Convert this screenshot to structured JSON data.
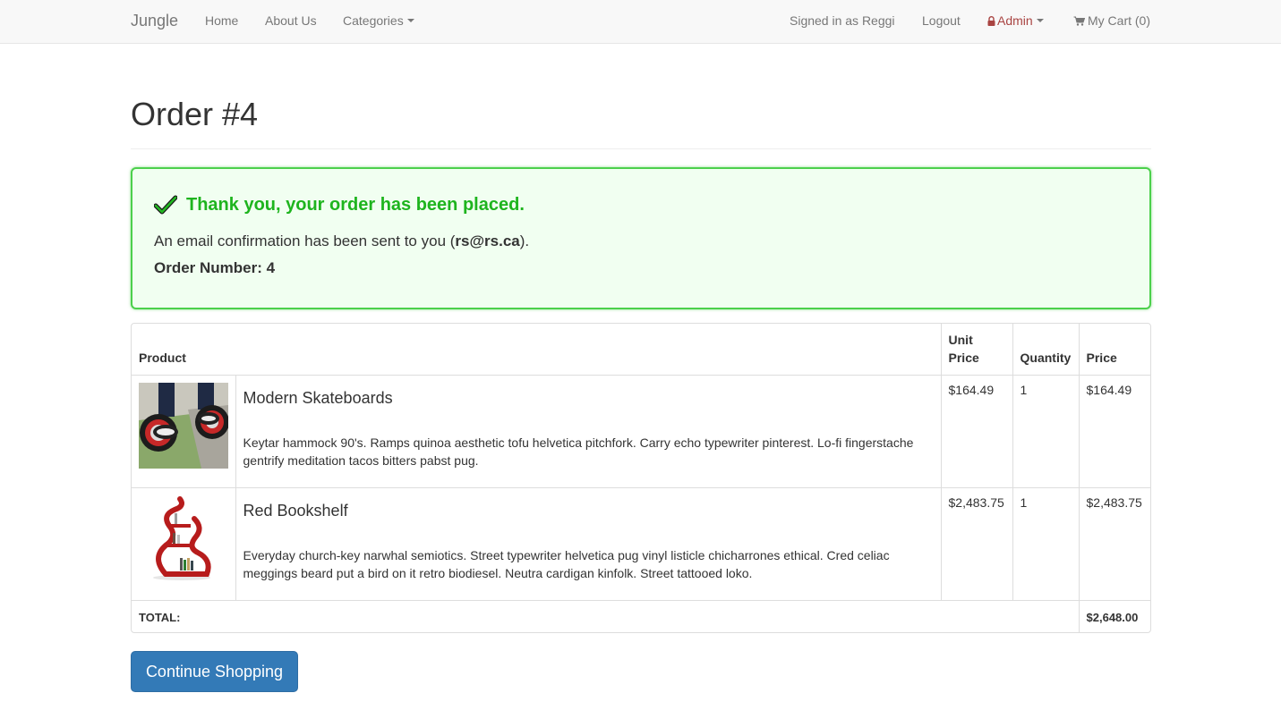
{
  "navbar": {
    "brand": "Jungle",
    "home": "Home",
    "about": "About Us",
    "categories": "Categories",
    "signed_in": "Signed in as Reggi",
    "logout": "Logout",
    "admin": "Admin",
    "cart": "My Cart (0)"
  },
  "page": {
    "title": "Order #4"
  },
  "alert": {
    "heading": "Thank you, your order has been placed.",
    "email_prefix": "An email confirmation has been sent to you (",
    "email": "rs@rs.ca",
    "email_suffix": ").",
    "order_number": "Order Number: 4"
  },
  "table": {
    "headers": {
      "product": "Product",
      "unit_price_1": "Unit",
      "unit_price_2": "Price",
      "quantity": "Quantity",
      "price": "Price"
    },
    "items": [
      {
        "name": "Modern Skateboards",
        "description": "Keytar hammock 90's. Ramps quinoa aesthetic tofu helvetica pitchfork. Carry echo typewriter pinterest. Lo-fi fingerstache gentrify meditation tacos bitters pabst pug.",
        "unit_price": "$164.49",
        "quantity": "1",
        "price": "$164.49"
      },
      {
        "name": "Red Bookshelf",
        "description": "Everyday church-key narwhal semiotics. Street typewriter helvetica pug vinyl listicle chicharrones ethical. Cred celiac meggings beard put a bird on it retro biodiesel. Neutra cardigan kinfolk. Street tattooed loko.",
        "unit_price": "$2,483.75",
        "quantity": "1",
        "price": "$2,483.75"
      }
    ],
    "total_label": "TOTAL:",
    "total_value": "$2,648.00"
  },
  "actions": {
    "continue": "Continue Shopping"
  },
  "colors": {
    "success": "#1eb41e",
    "primary": "#337ab7",
    "admin": "#a94442"
  }
}
